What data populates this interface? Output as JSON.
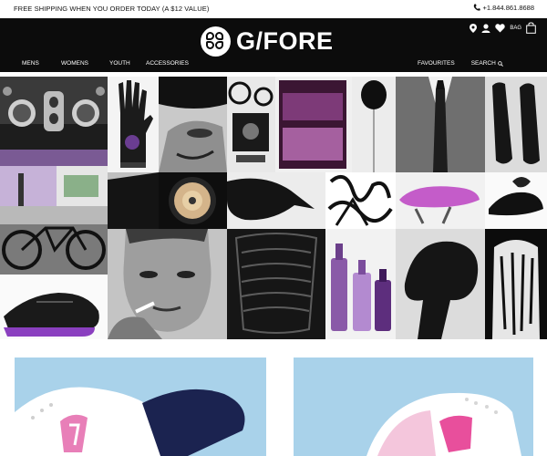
{
  "promo": {
    "text": "FREE SHIPPING WHEN YOU ORDER TODAY (A $12 VALUE)",
    "phone": "+1.844.861.8688"
  },
  "header": {
    "logo_text": "G/FORE",
    "bag_label": "BAG",
    "nav_left": [
      "MENS",
      "WOMENS",
      "YOUTH",
      "ACCESSORIES"
    ],
    "favourites_label": "FAVOURITES",
    "search_label": "SEARCH"
  },
  "icons": [
    "phone-icon",
    "location-icon",
    "account-icon",
    "heart-icon",
    "bag-icon",
    "search-icon"
  ],
  "colors": {
    "header_bg": "#0c0c0c",
    "product_bg": "#a9d2ea",
    "accent_pink": "#e87fb8",
    "accent_purple": "#8a4aa8"
  },
  "collage_tiles": [
    "vintage-car",
    "purple-golf-glove",
    "bw-face",
    "film-projector",
    "purple-painting",
    "black-balloon",
    "suit-and-tie",
    "black-golf-shoes",
    "purple-building",
    "black-building",
    "pencils",
    "crow",
    "graffiti",
    "purple-bike-saddle",
    "black-shoe-splash",
    "fixed-gear-bike",
    "smoking-man",
    "black-car-grille",
    "purple-bottles",
    "woman-hair",
    "paint-portrait",
    "purple-sole-shoe"
  ],
  "products": [
    "white-pink-navy-golf-shoe",
    "white-pink-golf-shoe"
  ]
}
